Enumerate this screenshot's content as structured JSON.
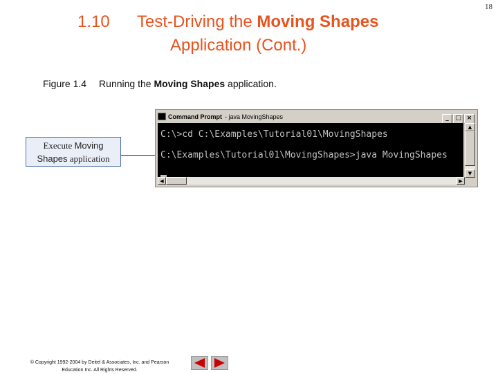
{
  "page_number": "18",
  "slide": {
    "section_number": "1.10",
    "title_line1_prefix": "Test-Driving the ",
    "title_line1_bold": "Moving Shapes",
    "title_line2": "Application (Cont.)"
  },
  "caption": {
    "figure_label": "Figure 1.4",
    "text_prefix": "Running the ",
    "text_bold": "Moving Shapes",
    "text_suffix": " application."
  },
  "callout": {
    "prefix": "Execute ",
    "bold1": "Moving",
    "bold2": "Shapes",
    "suffix": " application"
  },
  "window": {
    "title": "Command Prompt",
    "title_sub": "- java MovingShapes",
    "minimize_glyph": "_",
    "maximize_glyph": "□",
    "close_glyph": "×",
    "console_lines": [
      "C:\\>cd C:\\Examples\\Tutorial01\\MovingShapes",
      "C:\\Examples\\Tutorial01\\MovingShapes>java MovingShapes"
    ]
  },
  "footer": {
    "copyright_line1": "© Copyright 1992-2004 by Deitel & Associates, Inc. and Pearson",
    "copyright_line2": "Education Inc. All Rights Reserved."
  },
  "colors": {
    "title": "#e8531e",
    "arrow_red": "#cc0000",
    "console_bg": "#000000",
    "console_text": "#c0c0c0",
    "callout_border": "#4a6fa8"
  },
  "icons": {
    "prev": "triangle-left-icon",
    "next": "triangle-right-icon"
  }
}
